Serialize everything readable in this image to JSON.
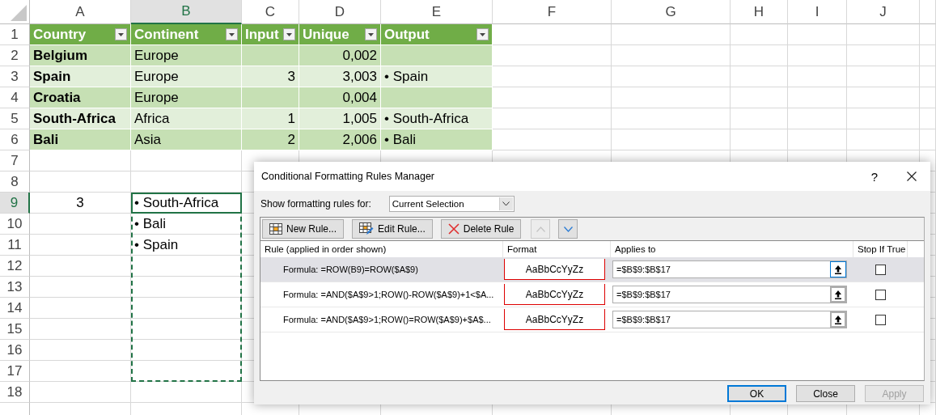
{
  "sheet": {
    "columns": [
      {
        "label": "A",
        "selected": false
      },
      {
        "label": "B",
        "selected": true
      },
      {
        "label": "C",
        "selected": false
      },
      {
        "label": "D",
        "selected": false
      },
      {
        "label": "E",
        "selected": false
      },
      {
        "label": "F",
        "selected": false
      },
      {
        "label": "G",
        "selected": false
      },
      {
        "label": "H",
        "selected": false
      },
      {
        "label": "I",
        "selected": false
      },
      {
        "label": "J",
        "selected": false
      }
    ],
    "rows": [
      {
        "label": "1",
        "selected": false,
        "kind": "table_header",
        "cells": [
          "Country",
          "Continent",
          "Input",
          "Unique",
          "Output"
        ]
      },
      {
        "label": "2",
        "selected": false,
        "kind": "table_row",
        "cells": [
          "Belgium",
          "Europe",
          null,
          "0,002",
          null
        ]
      },
      {
        "label": "3",
        "selected": false,
        "kind": "table_row",
        "cells": [
          "Spain",
          "Europe",
          "3",
          "3,003",
          "• Spain"
        ]
      },
      {
        "label": "4",
        "selected": false,
        "kind": "table_row",
        "cells": [
          "Croatia",
          "Europe",
          null,
          "0,004",
          null
        ]
      },
      {
        "label": "5",
        "selected": false,
        "kind": "table_row",
        "cells": [
          "South-Africa",
          "Africa",
          "1",
          "1,005",
          "• South-Africa"
        ]
      },
      {
        "label": "6",
        "selected": false,
        "kind": "table_row",
        "cells": [
          "Bali",
          "Asia",
          "2",
          "2,006",
          "• Bali"
        ]
      },
      {
        "label": "7",
        "selected": false,
        "kind": "plain"
      },
      {
        "label": "8",
        "selected": false,
        "kind": "plain"
      },
      {
        "label": "9",
        "selected": true,
        "kind": "plain",
        "cells": [
          "3",
          "• South-Africa"
        ]
      },
      {
        "label": "10",
        "selected": false,
        "kind": "plain",
        "cells": [
          null,
          "• Bali"
        ]
      },
      {
        "label": "11",
        "selected": false,
        "kind": "plain",
        "cells": [
          null,
          "• Spain"
        ]
      },
      {
        "label": "12",
        "selected": false,
        "kind": "plain"
      },
      {
        "label": "13",
        "selected": false,
        "kind": "plain"
      },
      {
        "label": "14",
        "selected": false,
        "kind": "plain"
      },
      {
        "label": "15",
        "selected": false,
        "kind": "plain"
      },
      {
        "label": "16",
        "selected": false,
        "kind": "plain"
      },
      {
        "label": "17",
        "selected": false,
        "kind": "plain"
      },
      {
        "label": "18",
        "selected": false,
        "kind": "plain"
      }
    ],
    "marquee": true
  },
  "dialog": {
    "title": "Conditional Formatting Rules Manager",
    "help": "?",
    "show_label": "Show formatting rules for:",
    "scope": "Current Selection",
    "toolbar": [
      {
        "kind": "new",
        "label": "New Rule..."
      },
      {
        "kind": "edit",
        "label": "Edit Rule..."
      },
      {
        "kind": "delete",
        "label": "Delete Rule"
      }
    ],
    "move_up": {
      "disabled": true
    },
    "move_down": {
      "disabled": false
    },
    "columns": [
      "Rule (applied in order shown)",
      "Format",
      "Applies to",
      "Stop If True"
    ],
    "rules": [
      {
        "formula": "Formula: =ROW(B9)=ROW($A$9)",
        "preview": "AaBbCcYyZz",
        "applies_to": "=$B$9:$B$17",
        "stop_if_true": false,
        "selected": true
      },
      {
        "formula": "Formula: =AND($A$9>1;ROW()-ROW($A$9)+1<$A...",
        "preview": "AaBbCcYyZz",
        "applies_to": "=$B$9:$B$17",
        "stop_if_true": false,
        "selected": false
      },
      {
        "formula": "Formula: =AND($A$9>1;ROW()=ROW($A$9)+$A$...",
        "preview": "AaBbCcYyZz",
        "applies_to": "=$B$9:$B$17",
        "stop_if_true": false,
        "selected": false
      }
    ],
    "buttons": [
      {
        "label": "OK",
        "default": true,
        "disabled": false
      },
      {
        "label": "Close",
        "default": false,
        "disabled": false
      },
      {
        "label": "Apply",
        "default": false,
        "disabled": true
      }
    ]
  }
}
